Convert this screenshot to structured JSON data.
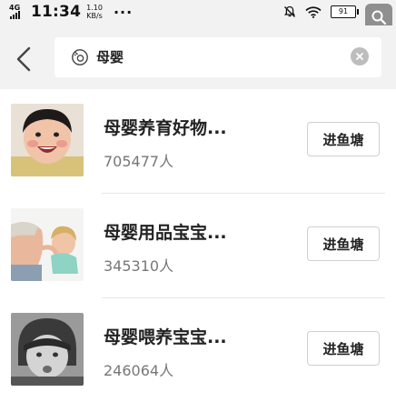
{
  "status_bar": {
    "network": "4G",
    "time": "11:34",
    "speed_value": "1.10",
    "speed_unit": "KB/s",
    "more": "···",
    "battery": "91"
  },
  "search": {
    "query": "母婴"
  },
  "results": [
    {
      "name": "母婴养育好物...",
      "members": "705477人",
      "button_label": "进鱼塘"
    },
    {
      "name": "母婴用品宝宝...",
      "members": "345310人",
      "button_label": "进鱼塘"
    },
    {
      "name": "母婴喂养宝宝...",
      "members": "246064人",
      "button_label": "进鱼塘"
    }
  ],
  "icons": {
    "back": "back-arrow-icon",
    "search": "search-icon",
    "clear": "clear-icon",
    "zoom": "zoom-icon"
  }
}
